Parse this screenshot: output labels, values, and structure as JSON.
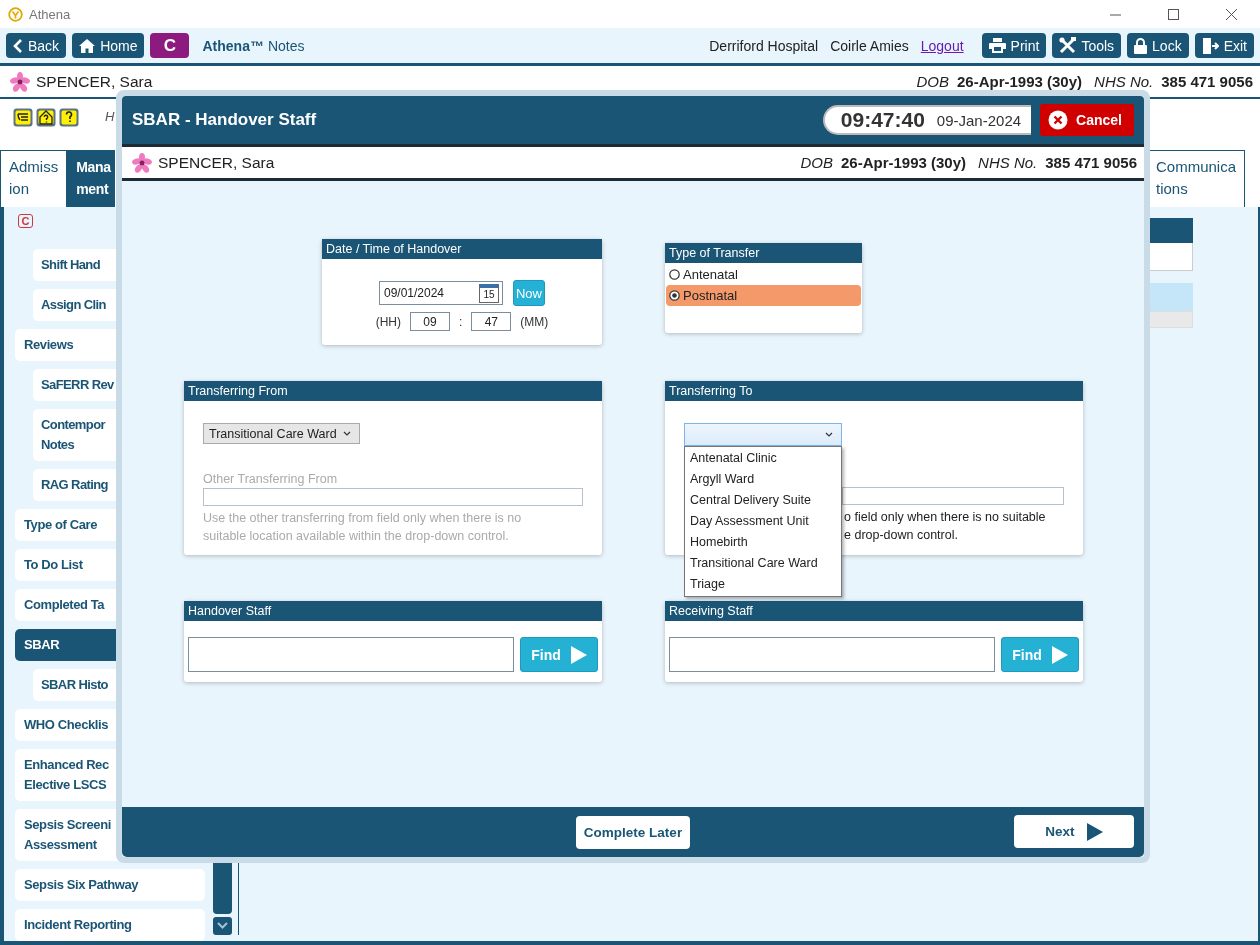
{
  "window": {
    "title": "Athena"
  },
  "toolbar": {
    "left_buttons": [
      {
        "label": "Back",
        "kind": "back"
      },
      {
        "label": "Home",
        "kind": "home"
      }
    ],
    "module_badge": "C",
    "app_name": "Athena™",
    "app_module": "Notes",
    "hospital": "Derriford Hospital",
    "user": "Coirle Amies",
    "logout": "Logout",
    "right_buttons": [
      {
        "label": "Print",
        "kind": "print"
      },
      {
        "label": "Tools",
        "kind": "tools"
      },
      {
        "label": "Lock",
        "kind": "lock"
      },
      {
        "label": "Exit",
        "kind": "exit"
      }
    ]
  },
  "patient": {
    "name": "SPENCER, Sara",
    "dob_label": "DOB",
    "dob": "26-Apr-1993 (30y)",
    "nhs_label": "NHS No.",
    "nhs": "385 471 9056"
  },
  "alert_strip": {
    "text": "H"
  },
  "tabs": [
    {
      "label": "Admiss\nion",
      "selected": false
    },
    {
      "label": "Mana\nment",
      "selected": true
    },
    {
      "label": "Communica\ntions",
      "selected": false
    }
  ],
  "sidebar": {
    "header_badge": "C",
    "leading_children": [
      {
        "label": "Shift Hand",
        "selected": false
      },
      {
        "label": "Assign Clin",
        "selected": false
      }
    ],
    "items": [
      {
        "label": "Reviews",
        "selected": false,
        "children": [
          {
            "label": "SaFERR Rev",
            "selected": false
          },
          {
            "label": "Contempor\nNotes",
            "selected": false
          },
          {
            "label": "RAG Rating",
            "selected": false
          }
        ]
      },
      {
        "label": "Type of Care",
        "selected": false
      },
      {
        "label": "To Do List",
        "selected": false
      },
      {
        "label": "Completed Ta",
        "selected": false
      },
      {
        "label": "SBAR",
        "selected": true,
        "children": [
          {
            "label": "SBAR Histo",
            "selected": false
          }
        ]
      },
      {
        "label": "WHO Checklis",
        "selected": false
      },
      {
        "label": "Enhanced Rec\nElective LSCS",
        "selected": false
      },
      {
        "label": "Sepsis Screeni\nAssessment",
        "selected": false
      },
      {
        "label": "Sepsis Six Pathway",
        "selected": false
      },
      {
        "label": "Incident Reporting",
        "selected": false
      }
    ]
  },
  "modal": {
    "title": "SBAR - Handover Staff",
    "time": "09:47:40",
    "date": "09-Jan-2024",
    "cancel": "Cancel",
    "patient": {
      "name": "SPENCER, Sara",
      "dob_label": "DOB",
      "dob": "26-Apr-1993 (30y)",
      "nhs_label": "NHS No.",
      "nhs": "385 471 9056"
    },
    "date_panel": {
      "title": "Date / Time of Handover",
      "date": "09/01/2024",
      "calendar_day": "15",
      "now": "Now",
      "hh_label": "(HH)",
      "hh": "09",
      "separator": ":",
      "mm": "47",
      "mm_label": "(MM)"
    },
    "type_panel": {
      "title": "Type of Transfer",
      "options": [
        {
          "label": "Antenatal",
          "selected": false
        },
        {
          "label": "Postnatal",
          "selected": true
        }
      ]
    },
    "from_panel": {
      "title": "Transferring From",
      "value": "Transitional Care Ward",
      "other_label": "Other Transferring From",
      "help": "Use the other transferring from field only when there is no suitable location available within the drop-down control.",
      "disabled": true
    },
    "to_panel": {
      "title": "Transferring To",
      "expanded": true,
      "disabled": false,
      "options": [
        "Antenatal Clinic",
        "Argyll Ward",
        "Central Delivery Suite",
        "Day Assessment Unit",
        "Homebirth",
        "Transitional Care Ward",
        "Triage"
      ],
      "help_lines": [
        "o field only when there is no suitable",
        "e drop-down control."
      ]
    },
    "handover_staff": {
      "title": "Handover Staff",
      "find": "Find"
    },
    "receiving_staff": {
      "title": "Receiving Staff",
      "find": "Find"
    },
    "footer": {
      "complete_later": "Complete Later",
      "next": "Next"
    }
  }
}
